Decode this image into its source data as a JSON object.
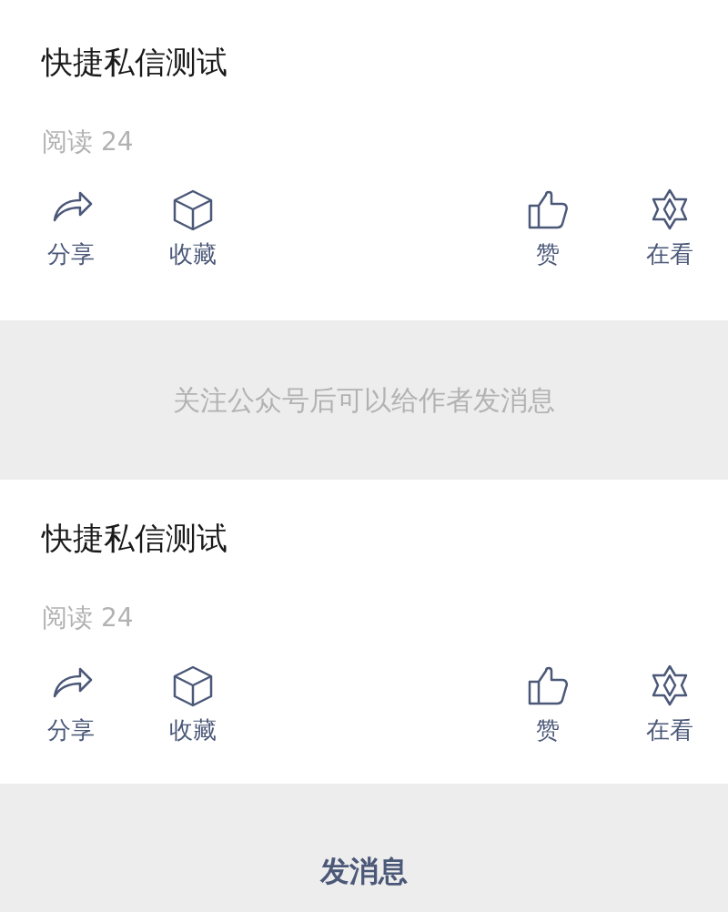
{
  "articles": [
    {
      "title": "快捷私信测试",
      "read": "阅读 24",
      "actions": [
        {
          "kind": "share",
          "label": "分享"
        },
        {
          "kind": "collect",
          "label": "收藏"
        },
        {
          "kind": "like",
          "label": "赞"
        },
        {
          "kind": "watching",
          "label": "在看"
        }
      ],
      "footer": {
        "kind": "notice",
        "text": "关注公众号后可以给作者发消息"
      }
    },
    {
      "title": "快捷私信测试",
      "read": "阅读 24",
      "actions": [
        {
          "kind": "share",
          "label": "分享"
        },
        {
          "kind": "collect",
          "label": "收藏"
        },
        {
          "kind": "like",
          "label": "赞"
        },
        {
          "kind": "watching",
          "label": "在看"
        }
      ],
      "footer": {
        "kind": "button",
        "text": "发消息"
      }
    }
  ]
}
